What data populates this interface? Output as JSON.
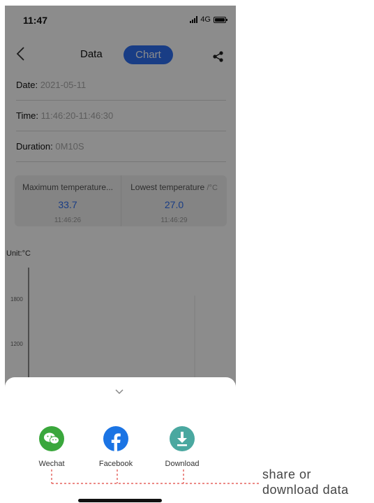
{
  "status_bar": {
    "time": "11:47",
    "network": "4G"
  },
  "nav": {
    "tab_data": "Data",
    "tab_chart": "Chart"
  },
  "info": {
    "date_label": "Date:",
    "date_value": "2021-05-11",
    "time_label": "Time:",
    "time_value": "11:46:20-11:46:30",
    "duration_label": "Duration:",
    "duration_value": "0M10S"
  },
  "summary": {
    "max_title": "Maximum temperature...",
    "max_value": "33.7",
    "max_time": "11:46:26",
    "min_title": "Lowest temperature",
    "min_unit": "/°C",
    "min_value": "27.0",
    "min_time": "11:46:29"
  },
  "chart": {
    "unit_label": "Unit:°C",
    "ticks": [
      "1800",
      "1200"
    ]
  },
  "share_sheet": {
    "options": [
      {
        "label": "Wechat",
        "icon": "wechat-icon",
        "color": "#3aa73c"
      },
      {
        "label": "Facebook",
        "icon": "facebook-icon",
        "color": "#1b74e4"
      },
      {
        "label": "Download",
        "icon": "download-icon",
        "color": "#4aa8a0"
      }
    ]
  },
  "annotation": {
    "line1": "share or",
    "line2": "download data",
    "color": "#e0443e"
  },
  "colors": {
    "accent": "#2f6ff2"
  }
}
